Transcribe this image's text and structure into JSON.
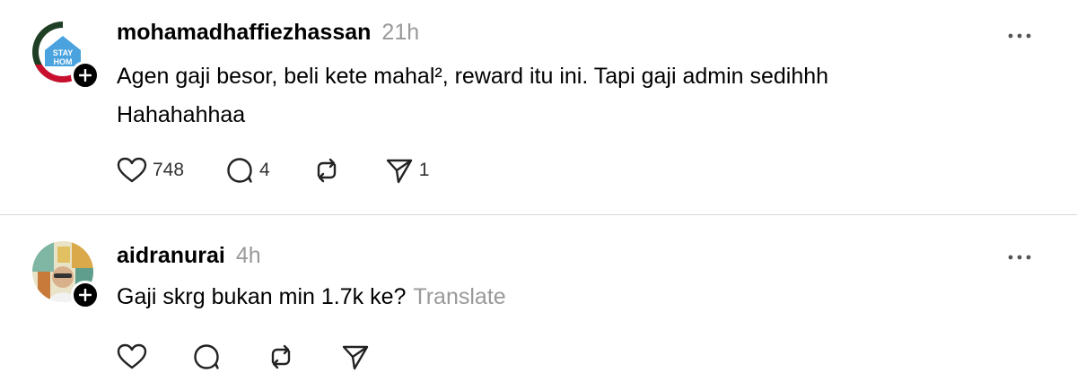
{
  "posts": [
    {
      "username": "mohamadhaffiezhassan",
      "time": "21h",
      "text_line1": "Agen gaji besor, beli kete mahal², reward itu ini. Tapi gaji admin sedihhh",
      "text_line2": "Hahahahhaa",
      "avatar_text_1": "STAY",
      "avatar_text_2": "HOM",
      "likes": "748",
      "replies": "4",
      "reposts": "",
      "shares": "1"
    },
    {
      "username": "aidranurai",
      "time": "4h",
      "text": "Gaji skrg bukan min 1.7k ke?",
      "translate_label": "Translate",
      "likes": "",
      "replies": "",
      "reposts": "",
      "shares": ""
    }
  ],
  "icons": {
    "like": "heart-icon",
    "reply": "comment-icon",
    "repost": "repost-icon",
    "share": "send-icon",
    "more": "more-options-icon",
    "follow": "plus-icon"
  }
}
